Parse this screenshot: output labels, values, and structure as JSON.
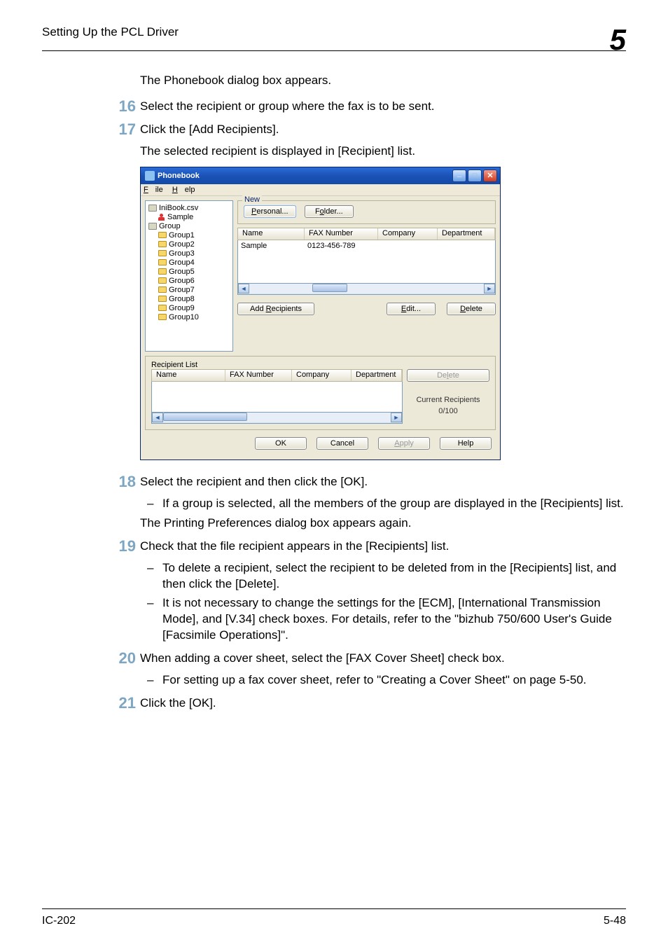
{
  "header": {
    "title": "Setting Up the PCL Driver",
    "chapter": "5"
  },
  "intro": "The Phonebook dialog box appears.",
  "steps": {
    "s16": {
      "num": "16",
      "text": "Select the recipient or group where the fax is to be sent."
    },
    "s17": {
      "num": "17",
      "text": "Click the [Add Recipients].",
      "follow": "The selected recipient is displayed in [Recipient] list."
    },
    "s18": {
      "num": "18",
      "text": "Select the recipient and then click the [OK].",
      "sub": "If a group is selected, all the members of the group are displayed in the [Recipients] list.",
      "follow": "The Printing Preferences dialog box appears again."
    },
    "s19": {
      "num": "19",
      "text": "Check that the file recipient appears in the [Recipients] list.",
      "sub1": "To delete a recipient, select the recipient to be deleted from in the [Recipients] list, and then click the [Delete].",
      "sub2": "It is not necessary to change the settings for the [ECM], [International Transmission Mode], and [V.34] check boxes. For details, refer to the \"bizhub 750/600 User's Guide [Facsimile Operations]\"."
    },
    "s20": {
      "num": "20",
      "text": "When adding a cover sheet, select the [FAX Cover Sheet] check box.",
      "sub": "For setting up a fax cover sheet, refer to \"Creating a Cover Sheet\" on page 5-50."
    },
    "s21": {
      "num": "21",
      "text": "Click the [OK]."
    }
  },
  "dialog": {
    "title": "Phonebook",
    "menu_file": "File",
    "menu_file_u": "F",
    "menu_help": "Help",
    "menu_help_u": "H",
    "tree": {
      "book": "IniBook.csv",
      "sample": "Sample",
      "group": "Group",
      "folders": [
        "Group1",
        "Group2",
        "Group3",
        "Group4",
        "Group5",
        "Group6",
        "Group7",
        "Group8",
        "Group9",
        "Group10"
      ]
    },
    "new_legend": "New",
    "btn_personal": "Personal...",
    "u_personal": "P",
    "btn_folder": "Folder...",
    "u_folder": "o",
    "cols": {
      "name": "Name",
      "fax": "FAX Number",
      "company": "Company",
      "dept": "Department"
    },
    "row": {
      "name": "Sample",
      "fax": "0123-456-789",
      "company": "",
      "dept": ""
    },
    "btn_add": "Add Recipients",
    "u_add": "R",
    "btn_edit": "Edit...",
    "u_edit": "E",
    "btn_delete": "Delete",
    "u_delete": "D",
    "recip_legend": "Recipient List",
    "recip_delete": "Delete",
    "u_recip_delete": "l",
    "current_label": "Current Recipients",
    "current_count": "0/100",
    "btn_ok": "OK",
    "btn_cancel": "Cancel",
    "btn_apply": "Apply",
    "u_apply": "A",
    "btn_help": "Help"
  },
  "footer": {
    "left": "IC-202",
    "right": "5-48"
  }
}
